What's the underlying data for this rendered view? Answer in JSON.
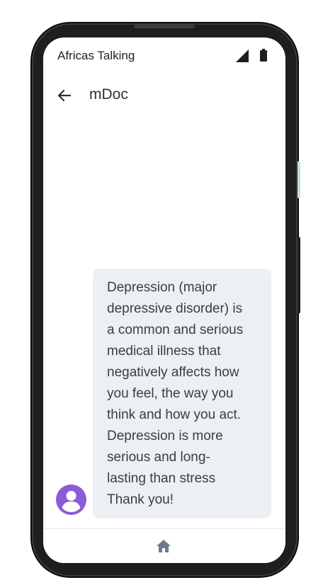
{
  "status_bar": {
    "carrier": "Africas Talking",
    "icons": [
      "signal-icon",
      "battery-icon"
    ]
  },
  "app_bar": {
    "back_icon": "arrow-left-icon",
    "title": "mDoc"
  },
  "chat": {
    "messages": [
      {
        "sender_icon": "user-avatar-icon",
        "text": "Depression (major\ndepressive disorder) is\na common and serious\nmedical illness that\nnegatively affects how\nyou feel, the way you\nthink and how you act.\nDepression is more\nserious and long-\nlasting than stress\nThank you!"
      }
    ]
  },
  "bottom_nav": {
    "home_icon": "home-icon"
  },
  "colors": {
    "avatar": "#8a5cd6",
    "bubble_background": "#ecf0f4",
    "home_icon": "#6f7a8a",
    "text_dark": "#2d2f3a"
  }
}
